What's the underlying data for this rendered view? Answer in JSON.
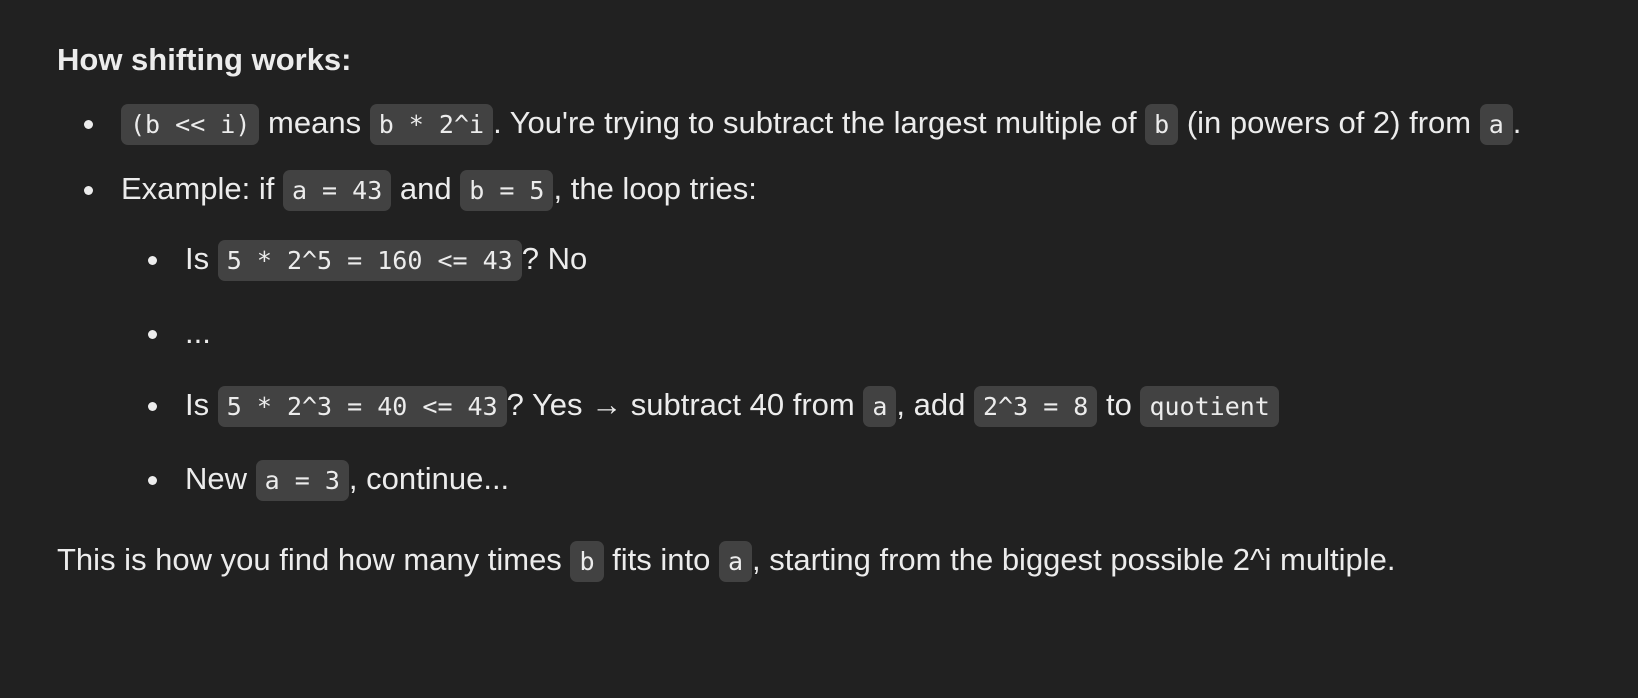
{
  "heading": "How shifting works:",
  "bullet1": {
    "code1": "(b << i)",
    "text1": " means ",
    "code2": "b * 2^i",
    "text2": ". You're trying to subtract the largest multiple of ",
    "code3": "b",
    "text3": " (in powers of 2) from ",
    "code4": "a",
    "text4": "."
  },
  "bullet2": {
    "text1": "Example: if ",
    "code1": "a = 43",
    "text2": " and ",
    "code2": "b = 5",
    "text3": ", the loop tries:",
    "sub": [
      {
        "text1": "Is ",
        "code1": "5 * 2^5 = 160 <= 43",
        "text2": "? No"
      },
      {
        "text1": "..."
      },
      {
        "text1": "Is ",
        "code1": "5 * 2^3 = 40 <= 43",
        "text2": "? Yes → subtract 40 from ",
        "code2": "a",
        "text3": ", add ",
        "code3": "2^3 = 8",
        "text4": " to ",
        "code4": "quotient"
      },
      {
        "text1": "New ",
        "code1": "a = 3",
        "text2": ", continue..."
      }
    ]
  },
  "closing": {
    "text1": "This is how you find how many times ",
    "code1": "b",
    "text2": " fits into ",
    "code2": "a",
    "text3": ", starting from the biggest possible 2^i multiple."
  }
}
